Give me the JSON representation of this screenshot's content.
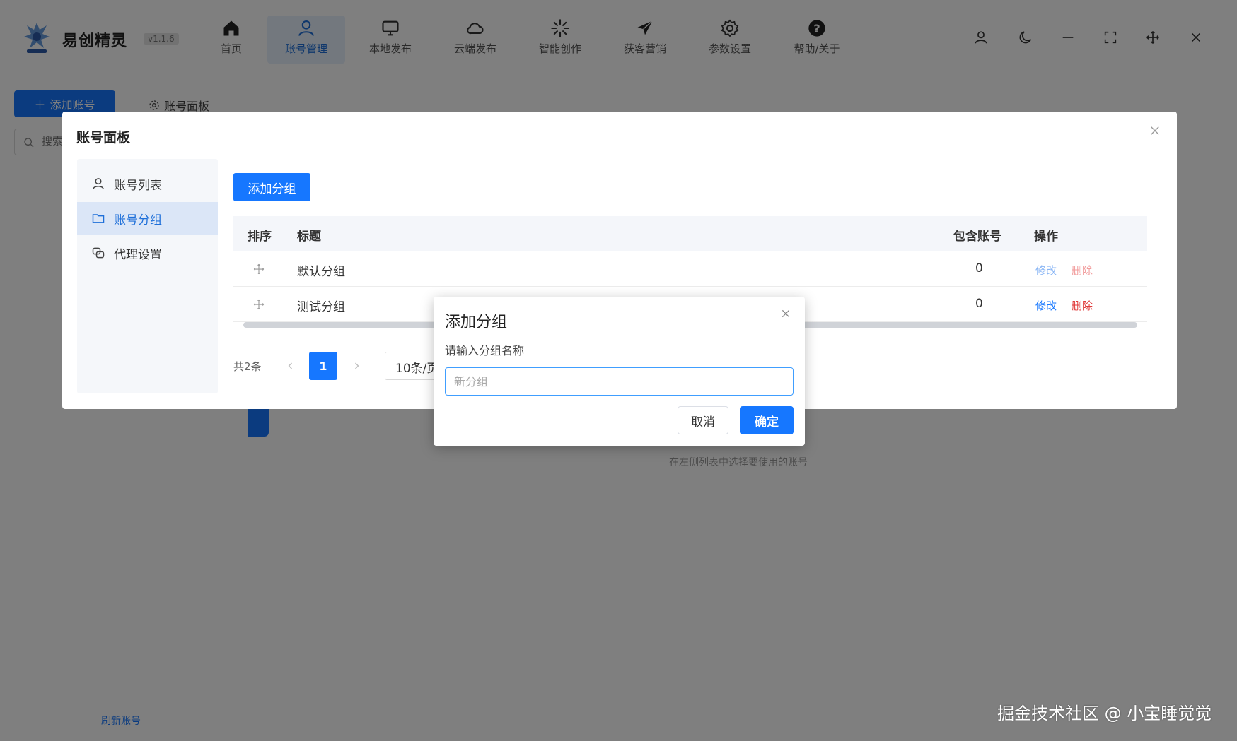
{
  "app": {
    "name": "易创精灵",
    "version": "v1.1.6"
  },
  "nav": [
    {
      "label": "首页",
      "icon": "home-icon"
    },
    {
      "label": "账号管理",
      "icon": "user-icon",
      "active": true
    },
    {
      "label": "本地发布",
      "icon": "monitor-icon"
    },
    {
      "label": "云端发布",
      "icon": "cloud-icon"
    },
    {
      "label": "智能创作",
      "icon": "sparkle-icon"
    },
    {
      "label": "获客营销",
      "icon": "paper-plane-icon"
    },
    {
      "label": "参数设置",
      "icon": "gear-icon"
    },
    {
      "label": "帮助/关于",
      "icon": "help-icon"
    }
  ],
  "toolbar_icons": [
    "user-icon",
    "moon-icon",
    "minimize-icon",
    "fullscreen-icon",
    "move-icon",
    "close-icon"
  ],
  "background": {
    "add_account": "添加账号",
    "account_panel": "账号面板",
    "search_placeholder": "搜索",
    "hint": "在左侧列表中选择要使用的账号",
    "refresh": "刷新账号"
  },
  "panel": {
    "title": "账号面板",
    "side": [
      {
        "label": "账号列表",
        "icon": "user-icon"
      },
      {
        "label": "账号分组",
        "icon": "folder-icon",
        "active": true
      },
      {
        "label": "代理设置",
        "icon": "proxy-icon"
      }
    ],
    "add_group": "添加分组",
    "table": {
      "headers": {
        "sort": "排序",
        "title": "标题",
        "count": "包含账号",
        "ops": "操作"
      },
      "rows": [
        {
          "title": "默认分组",
          "count": "0",
          "edit": "修改",
          "del": "删除"
        },
        {
          "title": "测试分组",
          "count": "0",
          "edit": "修改",
          "del": "删除"
        }
      ]
    },
    "pager": {
      "total": "共2条",
      "current": "1",
      "size": "10条/页"
    }
  },
  "modal": {
    "title": "添加分组",
    "label": "请输入分组名称",
    "placeholder": "新分组",
    "cancel": "取消",
    "ok": "确定"
  },
  "watermark": "掘金技术社区 @ 小宝睡觉觉",
  "colors": {
    "primary": "#1677ff",
    "danger": "#e03a3a",
    "overlay": "rgba(0,0,0,0.5)"
  }
}
